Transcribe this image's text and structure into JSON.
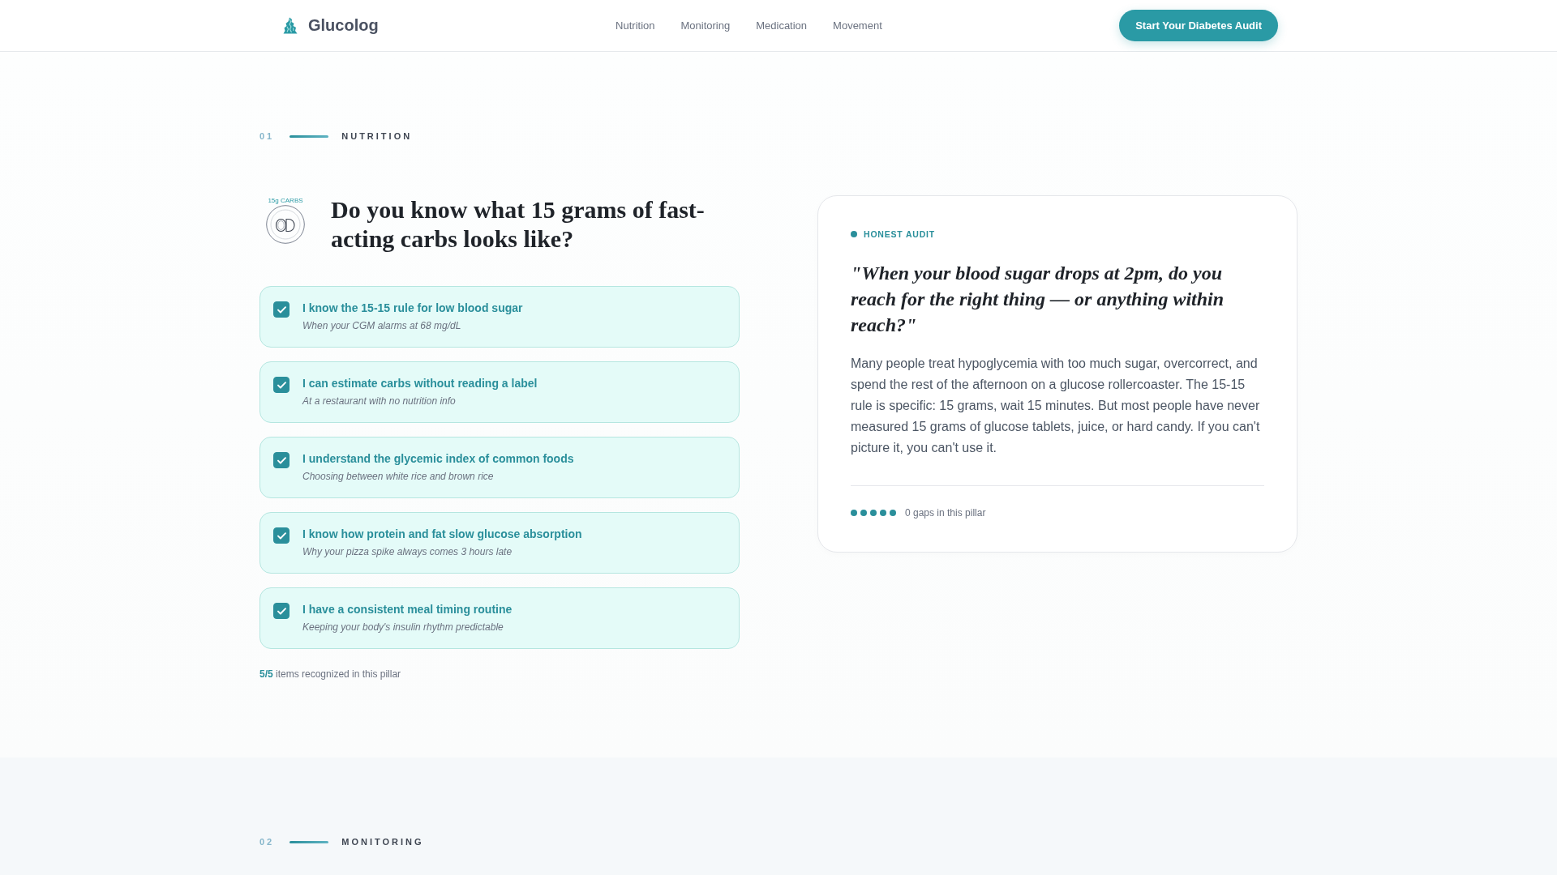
{
  "header": {
    "logo": "Glucolog",
    "nav": [
      "Nutrition",
      "Monitoring",
      "Medication",
      "Movement"
    ],
    "cta": "Start Your Diabetes Audit"
  },
  "sections": [
    {
      "number": "01",
      "title": "NUTRITION",
      "illustration_label": "15g CARBS",
      "question": "Do you know what 15 grams of fast-acting carbs looks like?",
      "items": [
        {
          "title": "I know the 15-15 rule for low blood sugar",
          "subtitle": "When your CGM alarms at 68 mg/dL",
          "checked": true
        },
        {
          "title": "I can estimate carbs without reading a label",
          "subtitle": "At a restaurant with no nutrition info",
          "checked": true
        },
        {
          "title": "I understand the glycemic index of common foods",
          "subtitle": "Choosing between white rice and brown rice",
          "checked": true
        },
        {
          "title": "I know how protein and fat slow glucose absorption",
          "subtitle": "Why your pizza spike always comes 3 hours late",
          "checked": true
        },
        {
          "title": "I have a consistent meal timing routine",
          "subtitle": "Keeping your body's insulin rhythm predictable",
          "checked": true
        }
      ],
      "summary": "**5/5** items recognized in this pillar",
      "audit_card": {
        "tag": "HONEST AUDIT",
        "quote": "\"When your blood sugar drops at 2pm, do you reach for the right thing — or anything within reach?\"",
        "body": "Many people treat hypoglycemia with too much sugar, overcorrect, and spend the rest of the afternoon on a glucose rollercoaster. The 15-15 rule is specific: 15 grams, wait 15 minutes. But most people have never measured 15 grams of glucose tablets, juice, or hard candy. If you can't picture it, you can't use it.",
        "dots": [
          {
            "filled": true
          },
          {
            "filled": true
          },
          {
            "filled": true
          },
          {
            "filled": true
          },
          {
            "filled": true
          }
        ],
        "gaps": "0 gaps in this pillar"
      }
    },
    {
      "number": "02",
      "title": "MONITORING"
    }
  ]
}
